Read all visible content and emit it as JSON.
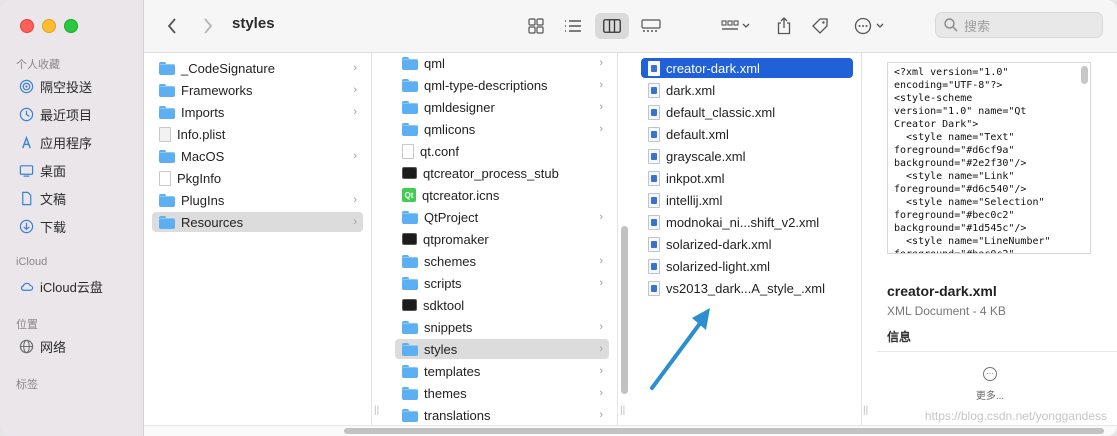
{
  "window": {
    "title": "styles"
  },
  "sidebar": {
    "sections": [
      {
        "title": "个人收藏",
        "items": [
          {
            "label": "隔空投送",
            "icon": "airdrop-icon"
          },
          {
            "label": "最近项目",
            "icon": "clock-icon"
          },
          {
            "label": "应用程序",
            "icon": "applications-icon"
          },
          {
            "label": "桌面",
            "icon": "desktop-icon"
          },
          {
            "label": "文稿",
            "icon": "document-icon"
          },
          {
            "label": "下载",
            "icon": "download-icon"
          }
        ]
      },
      {
        "title": "iCloud",
        "items": [
          {
            "label": "iCloud云盘",
            "icon": "cloud-icon"
          }
        ]
      },
      {
        "title": "位置",
        "items": [
          {
            "label": "网络",
            "icon": "network-icon"
          }
        ]
      },
      {
        "title": "标签",
        "items": []
      }
    ]
  },
  "toolbar": {
    "search_placeholder": "搜索"
  },
  "columns": {
    "col1": [
      {
        "name": "_CodeSignature",
        "type": "folder",
        "chevron": true
      },
      {
        "name": "Frameworks",
        "type": "folder",
        "chevron": true
      },
      {
        "name": "Imports",
        "type": "folder",
        "chevron": true
      },
      {
        "name": "Info.plist",
        "type": "plist",
        "chevron": false
      },
      {
        "name": "MacOS",
        "type": "folder",
        "chevron": true
      },
      {
        "name": "PkgInfo",
        "type": "doc",
        "chevron": false
      },
      {
        "name": "PlugIns",
        "type": "folder",
        "chevron": true
      },
      {
        "name": "Resources",
        "type": "folder",
        "chevron": true,
        "selected": true
      }
    ],
    "col2": [
      {
        "name": "qml",
        "type": "folder",
        "chevron": true
      },
      {
        "name": "qml-type-descriptions",
        "type": "folder",
        "chevron": true
      },
      {
        "name": "qmldesigner",
        "type": "folder",
        "chevron": true
      },
      {
        "name": "qmlicons",
        "type": "folder",
        "chevron": true
      },
      {
        "name": "qt.conf",
        "type": "doc",
        "chevron": false
      },
      {
        "name": "qtcreator_process_stub",
        "type": "term",
        "chevron": false
      },
      {
        "name": "qtcreator.icns",
        "type": "qt",
        "chevron": false
      },
      {
        "name": "QtProject",
        "type": "folder",
        "chevron": true
      },
      {
        "name": "qtpromaker",
        "type": "term",
        "chevron": false
      },
      {
        "name": "schemes",
        "type": "folder",
        "chevron": true
      },
      {
        "name": "scripts",
        "type": "folder",
        "chevron": true
      },
      {
        "name": "sdktool",
        "type": "term",
        "chevron": false
      },
      {
        "name": "snippets",
        "type": "folder",
        "chevron": true
      },
      {
        "name": "styles",
        "type": "folder",
        "chevron": true,
        "selected": true
      },
      {
        "name": "templates",
        "type": "folder",
        "chevron": true
      },
      {
        "name": "themes",
        "type": "folder",
        "chevron": true
      },
      {
        "name": "translations",
        "type": "folder",
        "chevron": true
      }
    ],
    "col3": [
      {
        "name": "creator-dark.xml",
        "type": "xml",
        "selected": true
      },
      {
        "name": "dark.xml",
        "type": "xml"
      },
      {
        "name": "default_classic.xml",
        "type": "xml"
      },
      {
        "name": "default.xml",
        "type": "xml"
      },
      {
        "name": "grayscale.xml",
        "type": "xml"
      },
      {
        "name": "inkpot.xml",
        "type": "xml"
      },
      {
        "name": "intellij.xml",
        "type": "xml"
      },
      {
        "name": "modnokai_ni...shift_v2.xml",
        "type": "xml"
      },
      {
        "name": "solarized-dark.xml",
        "type": "xml"
      },
      {
        "name": "solarized-light.xml",
        "type": "xml"
      },
      {
        "name": "vs2013_dark...A_style_.xml",
        "type": "xml"
      }
    ]
  },
  "preview": {
    "code": "<?xml version=\"1.0\"\nencoding=\"UTF-8\"?>\n<style-scheme\nversion=\"1.0\" name=\"Qt\nCreator Dark\">\n  <style name=\"Text\"\nforeground=\"#d6cf9a\"\nbackground=\"#2e2f30\"/>\n  <style name=\"Link\"\nforeground=\"#d6c540\"/>\n  <style name=\"Selection\"\nforeground=\"#bec0c2\"\nbackground=\"#1d545c\"/>\n  <style name=\"LineNumber\"\nforeground=\"#bec0c2\"",
    "file_name": "creator-dark.xml",
    "file_meta": "XML Document - 4 KB",
    "info_label": "信息",
    "more_label": "更多..."
  },
  "watermark": "https://blog.csdn.net/yonggandess",
  "colors": {
    "selection_blue": "#2060d8",
    "folder_blue": "#5cb0f2",
    "annotation_arrow": "#2b8fcf"
  }
}
